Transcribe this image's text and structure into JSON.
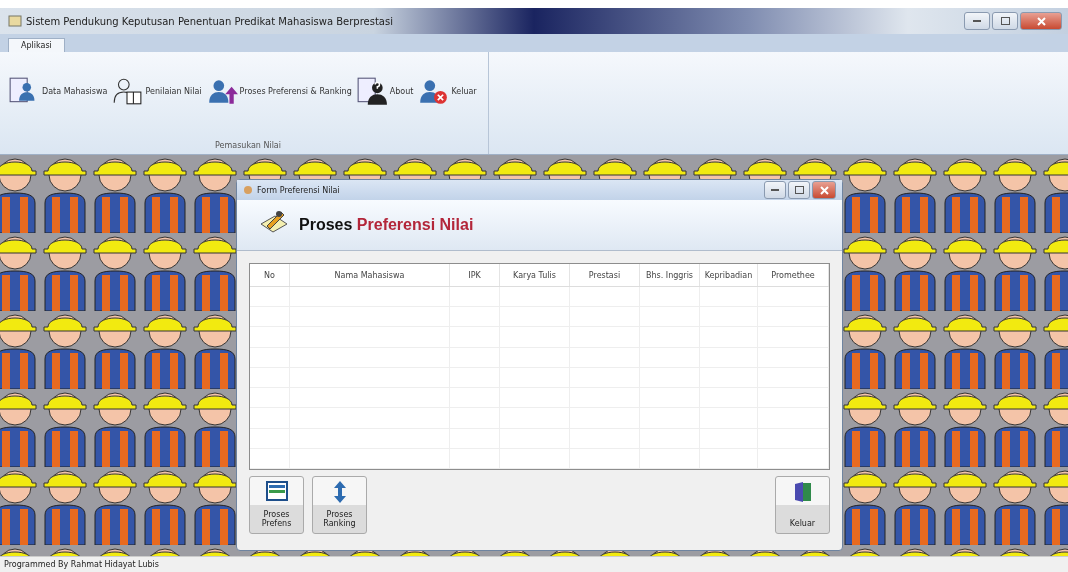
{
  "window": {
    "title": "Sistem Pendukung Keputusan Penentuan Predikat Mahasiswa Berprestasi"
  },
  "ribbon": {
    "tabs": [
      {
        "label": "Aplikasi",
        "selected": true
      }
    ],
    "buttons": [
      {
        "label": "Data Mahasiswa",
        "kind": "data"
      },
      {
        "label": "Penilaian Nilai",
        "kind": "form"
      },
      {
        "label": "Proses Preferensi & Ranking",
        "kind": "upload"
      },
      {
        "label": "About",
        "kind": "about"
      },
      {
        "label": "Keluar",
        "kind": "exit"
      }
    ],
    "group_label": "Pemasukan Nilai"
  },
  "child_window": {
    "title": "Form Preferensi Nilai",
    "heading_part_1": "Proses",
    "heading_part_2": "Preferensi Nilai",
    "table": {
      "columns": [
        "No",
        "Nama Mahasiswa",
        "IPK",
        "Karya Tulis",
        "Prestasi",
        "Bhs. Inggris",
        "Kepribadian",
        "Promethee"
      ]
    },
    "buttons": [
      {
        "label": "Proses Prefens",
        "kind": "list"
      },
      {
        "label": "Proses Ranking",
        "kind": "sort"
      },
      {
        "label": "Keluar",
        "kind": "door"
      }
    ]
  },
  "status_bar": {
    "text": "Programmed By Rahmat Hidayat Lubis"
  }
}
